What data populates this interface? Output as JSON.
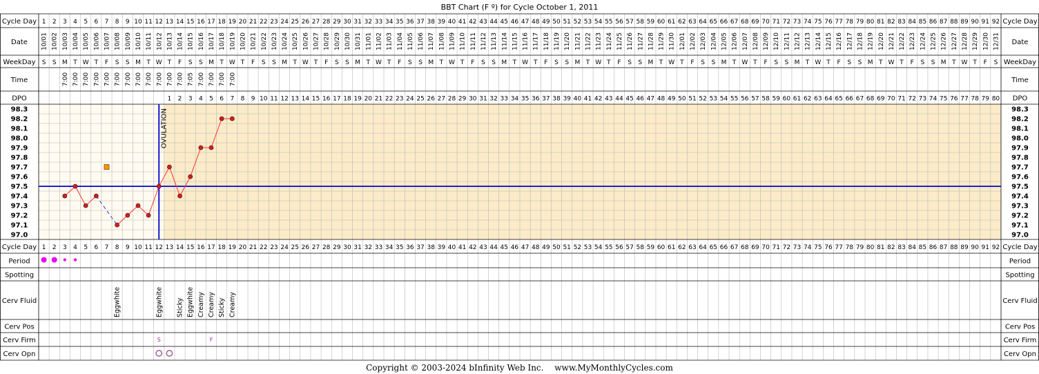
{
  "title": "BBT Chart (F º) for Cycle October 1, 2011",
  "row_labels": {
    "cycle_day": "Cycle Day",
    "date": "Date",
    "weekday": "WeekDay",
    "time": "Time",
    "dpo": "DPO",
    "period": "Period",
    "spotting": "Spotting",
    "cerv_fluid": "Cerv Fluid",
    "cerv_pos": "Cerv Pos",
    "cerv_firm": "Cerv Firm",
    "cerv_opn": "Cerv Opn"
  },
  "ovulation_label": "OVULATION",
  "colors": {
    "border": "#cc99cc",
    "header_bg": "#ffffff",
    "pre_ovulation_bg": "#fffbf0",
    "post_ovulation_bg": "#fbebc8",
    "grid": "#b8b8b8",
    "line": "#ff3333",
    "point": "#cc2222",
    "ovulation_line": "#0000cc",
    "coverline": "#0000cc",
    "period": "#ee00ee",
    "spotting_marker": "#ff9900"
  },
  "chart_data": {
    "type": "line",
    "title": "BBT Chart (F º) for Cycle October 1, 2011",
    "xlabel": "Cycle Day",
    "ylabel": "",
    "ylim": [
      97.0,
      98.3
    ],
    "yticks": [
      "98.3",
      "98.2",
      "98.1",
      "98.0",
      "97.9",
      "97.8",
      "97.7",
      "97.6",
      "97.5",
      "97.4",
      "97.3",
      "97.2",
      "97.1",
      "97.0"
    ],
    "cycle_days": 92,
    "dates": [
      "10/01",
      "10/02",
      "10/03",
      "10/04",
      "10/05",
      "10/06",
      "10/07",
      "10/08",
      "10/09",
      "10/10",
      "10/11",
      "10/12",
      "10/13",
      "10/14",
      "10/15",
      "10/16",
      "10/17",
      "10/18",
      "10/19",
      "10/20",
      "10/21",
      "10/22",
      "10/23",
      "10/24",
      "10/25",
      "10/26",
      "10/27",
      "10/28",
      "10/29",
      "10/30",
      "10/31",
      "11/01",
      "11/02",
      "11/03",
      "11/04",
      "11/05",
      "11/06",
      "11/07",
      "11/08",
      "11/09",
      "11/10",
      "11/11",
      "11/12",
      "11/13",
      "11/14",
      "11/15",
      "11/16",
      "11/17",
      "11/18",
      "11/19",
      "11/20",
      "11/21",
      "11/22",
      "11/23",
      "11/24",
      "11/25",
      "11/26",
      "11/27",
      "11/28",
      "11/29",
      "11/30",
      "12/01",
      "12/02",
      "12/03",
      "12/04",
      "12/05",
      "12/06",
      "12/07",
      "12/08",
      "12/09",
      "12/10",
      "12/11",
      "12/12",
      "12/13",
      "12/14",
      "12/15",
      "12/16",
      "12/17",
      "12/18",
      "12/19",
      "12/20",
      "12/21",
      "12/22",
      "12/23",
      "12/24",
      "12/25",
      "12/26",
      "12/27",
      "12/28",
      "12/29",
      "12/30",
      "12/31"
    ],
    "weekdays": [
      "S",
      "S",
      "M",
      "T",
      "W",
      "T",
      "F",
      "S",
      "S",
      "M",
      "T",
      "W",
      "T",
      "F",
      "S",
      "S",
      "M",
      "T",
      "W",
      "T",
      "F",
      "S",
      "S",
      "M",
      "T",
      "W",
      "T",
      "F",
      "S",
      "S",
      "M",
      "T",
      "W",
      "T",
      "F",
      "S",
      "S",
      "M",
      "T",
      "W",
      "T",
      "F",
      "S",
      "S",
      "M",
      "T",
      "W",
      "T",
      "F",
      "S",
      "S",
      "M",
      "T",
      "W",
      "T",
      "F",
      "S",
      "S",
      "M",
      "T",
      "W",
      "T",
      "F",
      "S",
      "S",
      "M",
      "T",
      "W",
      "T",
      "F",
      "S",
      "S",
      "M",
      "T",
      "W",
      "T",
      "F",
      "S",
      "S",
      "M",
      "T",
      "W",
      "T",
      "F",
      "S",
      "S",
      "M",
      "T",
      "W",
      "T",
      "F",
      "S"
    ],
    "times": [
      "",
      "",
      "7:00",
      "7:00",
      "7:00",
      "7:00",
      "7:00",
      "7:00",
      "7:00",
      "7:00",
      "7:00",
      "7:00",
      "7:00",
      "7:00",
      "7:05",
      "7:00",
      "7:00",
      "7:00",
      "7:00"
    ],
    "dpo_start_day": 13,
    "dpo_max": 80,
    "temperatures": [
      null,
      null,
      97.4,
      97.5,
      97.3,
      97.4,
      null,
      97.1,
      97.2,
      97.3,
      97.2,
      97.5,
      97.7,
      97.4,
      97.6,
      97.9,
      97.9,
      98.2,
      98.2
    ],
    "dashed_segment": [
      [
        6,
        97.4
      ],
      [
        8,
        97.1
      ]
    ],
    "discarded_temp": {
      "day": 7,
      "value": 97.7
    },
    "ovulation_day": 12,
    "coverline": 97.5,
    "period": [
      {
        "day": 1,
        "size": "heavy"
      },
      {
        "day": 2,
        "size": "heavy"
      },
      {
        "day": 3,
        "size": "light"
      },
      {
        "day": 4,
        "size": "light"
      }
    ],
    "cerv_fluid": [
      {
        "day": 8,
        "text": "Eggwhite"
      },
      {
        "day": 12,
        "text": "Eggwhite"
      },
      {
        "day": 14,
        "text": "Sticky"
      },
      {
        "day": 15,
        "text": "Eggwhite"
      },
      {
        "day": 16,
        "text": "Creamy"
      },
      {
        "day": 17,
        "text": "Creamy"
      },
      {
        "day": 18,
        "text": "Sticky"
      },
      {
        "day": 19,
        "text": "Creamy"
      }
    ],
    "cerv_firm": [
      {
        "day": 12,
        "text": "S"
      },
      {
        "day": 17,
        "text": "F"
      }
    ],
    "cerv_opn": [
      {
        "day": 12,
        "type": "open"
      },
      {
        "day": 13,
        "type": "open"
      }
    ]
  },
  "footer": {
    "copyright": "Copyright © 2003-2024 bInfinity Web Inc.",
    "site": "www.MyMonthlyCycles.com"
  }
}
